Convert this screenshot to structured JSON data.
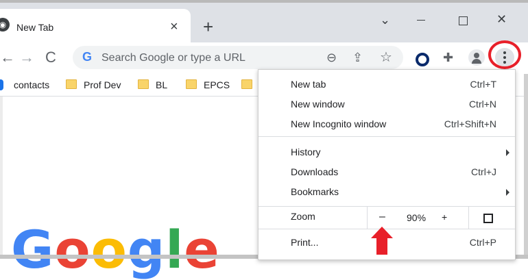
{
  "tab": {
    "title": "New Tab",
    "close_glyph": "×",
    "favicon": "chrome-icon"
  },
  "new_tab_glyph": "+",
  "window_controls": {
    "search_glyph": "⌄",
    "close_glyph": "✕"
  },
  "toolbar": {
    "back_glyph": "←",
    "forward_glyph": "→",
    "reload_glyph": "C",
    "omnibox_placeholder": "Search Google or type a URL",
    "google_g": "G",
    "zoom_glyph": "⊖",
    "share_glyph": "⇪",
    "star_glyph": "☆",
    "puzzle_glyph": "✚"
  },
  "bookmarks": [
    {
      "label": "contacts",
      "icon": "bookmark-icon"
    },
    {
      "label": "Prof Dev",
      "icon": "folder-icon"
    },
    {
      "label": "BL",
      "icon": "folder-icon"
    },
    {
      "label": "EPCS",
      "icon": "folder-icon"
    }
  ],
  "menu": {
    "items": [
      {
        "label": "New tab",
        "shortcut": "Ctrl+T"
      },
      {
        "label": "New window",
        "shortcut": "Ctrl+N"
      },
      {
        "label": "New Incognito window",
        "shortcut": "Ctrl+Shift+N"
      },
      {
        "label": "History",
        "shortcut": ""
      },
      {
        "label": "Downloads",
        "shortcut": "Ctrl+J"
      },
      {
        "label": "Bookmarks",
        "shortcut": ""
      },
      {
        "label": "Print...",
        "shortcut": "Ctrl+P"
      }
    ],
    "zoom": {
      "label": "Zoom",
      "minus": "–",
      "value": "90%",
      "plus": "+"
    }
  },
  "google_logo_letters": [
    "G",
    "o",
    "o",
    "g",
    "l",
    "e"
  ],
  "colors": {
    "annotation_red": "#e8202a",
    "tabstrip": "#dee1e6",
    "google_blue": "#4285f4",
    "google_red": "#ea4335",
    "google_yellow": "#fbbc05",
    "google_green": "#34a853"
  }
}
